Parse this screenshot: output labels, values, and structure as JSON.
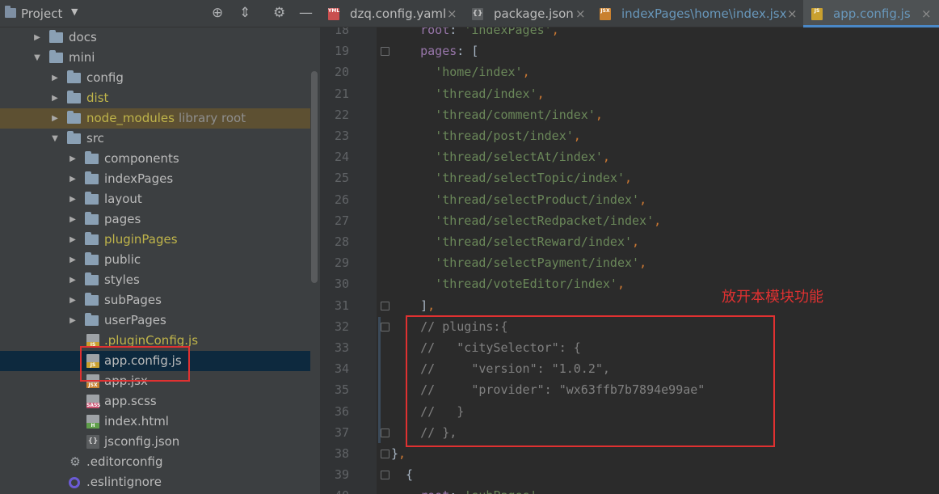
{
  "project_panel": {
    "title": "Project",
    "header_icons": [
      "target-icon",
      "collapse-icon",
      "gear-icon",
      "minimize-icon"
    ],
    "tree": [
      {
        "label": "docs",
        "type": "folder",
        "level": 1,
        "expanded": false
      },
      {
        "label": "mini",
        "type": "folder",
        "level": 1,
        "expanded": true
      },
      {
        "label": "config",
        "type": "folder",
        "level": 2,
        "expanded": false
      },
      {
        "label": "dist",
        "type": "folder",
        "level": 2,
        "expanded": false,
        "color": "yellow"
      },
      {
        "label": "node_modules",
        "suffix": "library root",
        "type": "folder",
        "level": 2,
        "expanded": false,
        "color": "yellow",
        "excluded": true
      },
      {
        "label": "src",
        "type": "folder",
        "level": 2,
        "expanded": true
      },
      {
        "label": "components",
        "type": "folder",
        "level": 3,
        "expanded": false
      },
      {
        "label": "indexPages",
        "type": "folder",
        "level": 3,
        "expanded": false
      },
      {
        "label": "layout",
        "type": "folder",
        "level": 3,
        "expanded": false
      },
      {
        "label": "pages",
        "type": "folder",
        "level": 3,
        "expanded": false
      },
      {
        "label": "pluginPages",
        "type": "folder",
        "level": 3,
        "expanded": false,
        "color": "yellow"
      },
      {
        "label": "public",
        "type": "folder",
        "level": 3,
        "expanded": false
      },
      {
        "label": "styles",
        "type": "folder",
        "level": 3,
        "expanded": false
      },
      {
        "label": "subPages",
        "type": "folder",
        "level": 3,
        "expanded": false
      },
      {
        "label": "userPages",
        "type": "folder",
        "level": 3,
        "expanded": false
      },
      {
        "label": ".pluginConfig.js",
        "type": "file",
        "icon": "js",
        "level": 3,
        "color": "yellow"
      },
      {
        "label": "app.config.js",
        "type": "file",
        "icon": "js",
        "level": 3,
        "selected": true
      },
      {
        "label": "app.jsx",
        "type": "file",
        "icon": "jsx",
        "level": 3
      },
      {
        "label": "app.scss",
        "type": "file",
        "icon": "sass",
        "level": 3
      },
      {
        "label": "index.html",
        "type": "file",
        "icon": "html",
        "level": 3
      },
      {
        "label": "jsconfig.json",
        "type": "file",
        "icon": "json",
        "level": 3
      },
      {
        "label": ".editorconfig",
        "type": "file",
        "icon": "gear",
        "level": 2
      },
      {
        "label": ".eslintignore",
        "type": "file",
        "icon": "eslint",
        "level": 2
      }
    ]
  },
  "tabs": [
    {
      "label": "dzq.config.yaml",
      "icon": "YML",
      "active": false
    },
    {
      "label": "package.json",
      "icon": "json",
      "active": false
    },
    {
      "label": "indexPages\\home\\index.jsx",
      "icon": "JSX",
      "active": false,
      "color": "blue"
    },
    {
      "label": "app.config.js",
      "icon": "JS",
      "active": true
    }
  ],
  "editor": {
    "lines": [
      {
        "n": "18",
        "text": "    root: 'indexPages',"
      },
      {
        "n": "19",
        "text": "    pages: ["
      },
      {
        "n": "20",
        "text": "      'home/index',"
      },
      {
        "n": "21",
        "text": "      'thread/index',"
      },
      {
        "n": "22",
        "text": "      'thread/comment/index',"
      },
      {
        "n": "23",
        "text": "      'thread/post/index',"
      },
      {
        "n": "24",
        "text": "      'thread/selectAt/index',"
      },
      {
        "n": "25",
        "text": "      'thread/selectTopic/index',"
      },
      {
        "n": "26",
        "text": "      'thread/selectProduct/index',"
      },
      {
        "n": "27",
        "text": "      'thread/selectRedpacket/index',"
      },
      {
        "n": "28",
        "text": "      'thread/selectReward/index',"
      },
      {
        "n": "29",
        "text": "      'thread/selectPayment/index',"
      },
      {
        "n": "30",
        "text": "      'thread/voteEditor/index',"
      },
      {
        "n": "31",
        "text": "    ],"
      },
      {
        "n": "32",
        "text": "    // plugins:{"
      },
      {
        "n": "33",
        "text": "    //   \"citySelector\": {"
      },
      {
        "n": "34",
        "text": "    //     \"version\": \"1.0.2\","
      },
      {
        "n": "35",
        "text": "    //     \"provider\": \"wx63ffb7b7894e99ae\""
      },
      {
        "n": "36",
        "text": "    //   }"
      },
      {
        "n": "37",
        "text": "    // },"
      },
      {
        "n": "38",
        "text": "},"
      },
      {
        "n": "39",
        "text": "  {"
      },
      {
        "n": "40",
        "text": "    root: 'subPages',"
      }
    ]
  },
  "annotation": "放开本模块功能",
  "colors": {
    "panel_bg": "#3c3f41",
    "editor_bg": "#2b2b2b",
    "selection": "#0d293e",
    "string": "#6a8759",
    "comment": "#808080",
    "highlight_red": "#e03131",
    "active_tab_text": "#6897bb"
  }
}
